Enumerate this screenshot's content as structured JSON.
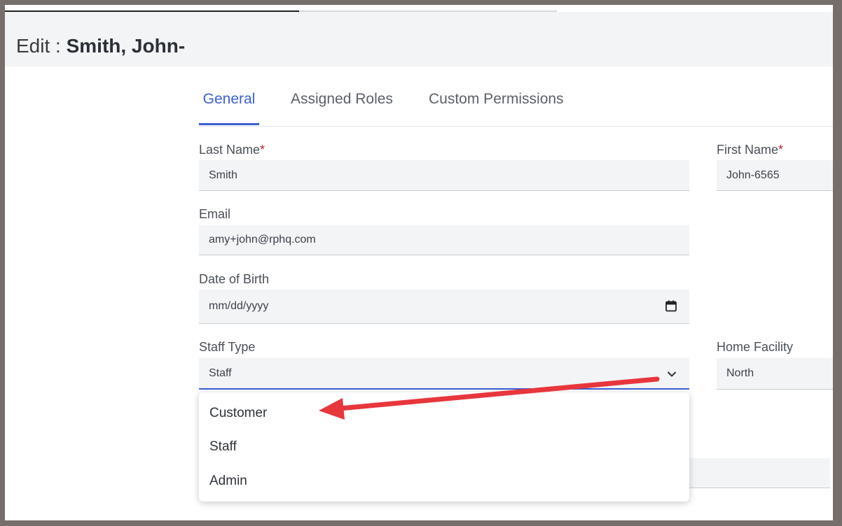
{
  "header": {
    "prefix": "Edit : ",
    "name": "Smith, John-"
  },
  "tabs": [
    {
      "label": "General",
      "active": true
    },
    {
      "label": "Assigned Roles",
      "active": false
    },
    {
      "label": "Custom Permissions",
      "active": false
    }
  ],
  "form": {
    "last_name": {
      "label": "Last Name",
      "required": "*",
      "value": "Smith"
    },
    "first_name": {
      "label": "First Name",
      "required": "*",
      "value": "John-6565"
    },
    "email": {
      "label": "Email",
      "value": "amy+john@rphq.com"
    },
    "dob": {
      "label": "Date of Birth",
      "value": "mm/dd/yyyy"
    },
    "staff_type": {
      "label": "Staff Type",
      "value": "Staff"
    },
    "home_facility": {
      "label": "Home Facility",
      "value": "North"
    }
  },
  "dropdown": {
    "options": [
      "Customer",
      "Staff",
      "Admin"
    ]
  },
  "colors": {
    "accent": "#3b5fd4",
    "arrow": "#e8363d",
    "required": "#b3262f"
  },
  "icons": {
    "calendar": "calendar-icon",
    "chevron": "chevron-down-icon"
  }
}
